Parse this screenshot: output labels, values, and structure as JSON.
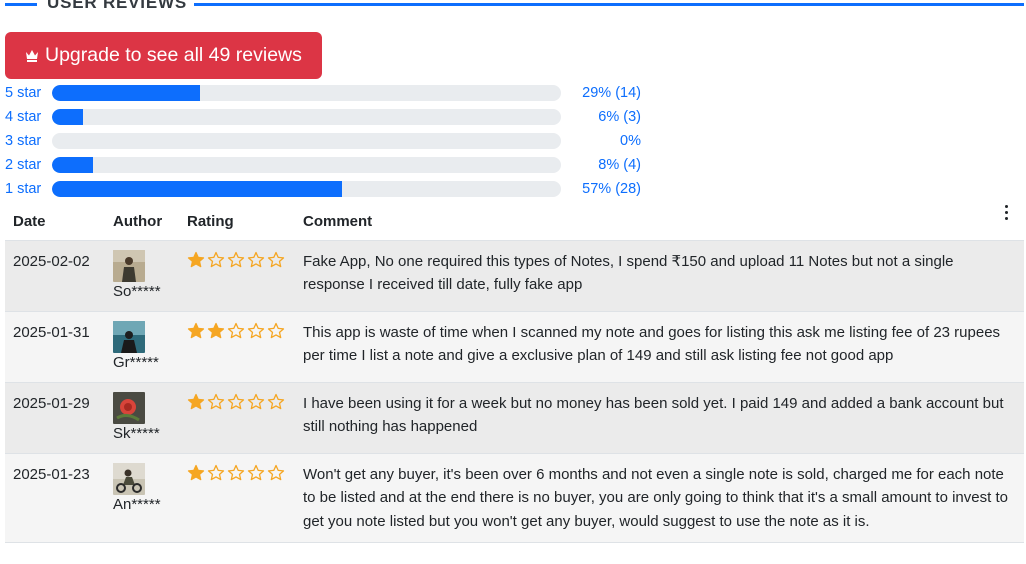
{
  "section": {
    "title": "USER REVIEWS"
  },
  "upgrade": {
    "label": "Upgrade to see all 49 reviews",
    "icon": "crown-icon",
    "color": "#dc3545"
  },
  "distribution": [
    {
      "label": "5 star",
      "percent": 29,
      "text": "29% (14)"
    },
    {
      "label": "4 star",
      "percent": 6,
      "text": "6% (3)"
    },
    {
      "label": "3 star",
      "percent": 0,
      "text": "0%"
    },
    {
      "label": "2 star",
      "percent": 8,
      "text": "8% (4)"
    },
    {
      "label": "1 star",
      "percent": 57,
      "text": "57% (28)"
    }
  ],
  "table": {
    "headers": {
      "date": "Date",
      "author": "Author",
      "rating": "Rating",
      "comment": "Comment"
    },
    "menu_icon": "kebab-menu-icon",
    "rows": [
      {
        "date": "2025-02-02",
        "author": "So*****",
        "rating": 1,
        "comment": "Fake App, No one required this types of Notes, I spend ₹150 and upload 11 Notes but not a single response I received till date, fully fake app"
      },
      {
        "date": "2025-01-31",
        "author": "Gr*****",
        "rating": 2,
        "comment": "This app is waste of time when I scanned my note and goes for listing this ask me listing fee of 23 rupees per time I list a note and give a exclusive plan of 149 and still ask listing fee not good app"
      },
      {
        "date": "2025-01-29",
        "author": "Sk*****",
        "rating": 1,
        "comment": "I have been using it for a week but no money has been sold yet. I paid 149 and added a bank account but still nothing has happened"
      },
      {
        "date": "2025-01-23",
        "author": "An*****",
        "rating": 1,
        "comment": "Won't get any buyer, it's been over 6 months and not even a single note is sold, charged me for each note to be listed and at the end there is no buyer, you are only going to think that it's a small amount to invest to get you note listed but you won't get any buyer, would suggest to use the note as it is."
      }
    ]
  },
  "colors": {
    "accent": "#0d6efd",
    "star": "#f5a623",
    "track": "#e9ecef"
  }
}
